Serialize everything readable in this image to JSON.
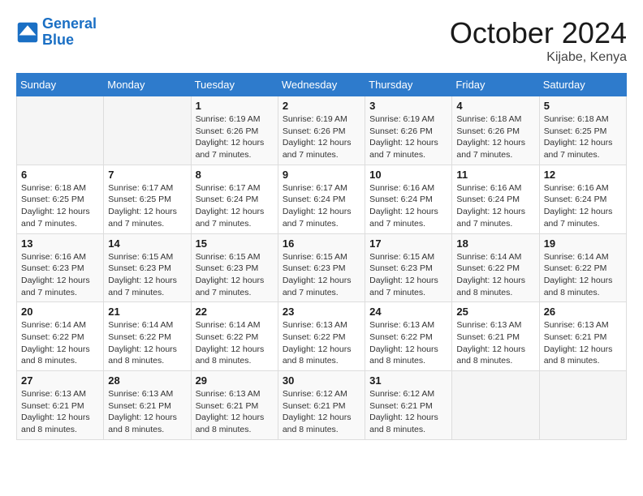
{
  "logo": {
    "line1": "General",
    "line2": "Blue"
  },
  "title": "October 2024",
  "location": "Kijabe, Kenya",
  "days_of_week": [
    "Sunday",
    "Monday",
    "Tuesday",
    "Wednesday",
    "Thursday",
    "Friday",
    "Saturday"
  ],
  "weeks": [
    [
      {
        "day": "",
        "info": ""
      },
      {
        "day": "",
        "info": ""
      },
      {
        "day": "1",
        "info": "Sunrise: 6:19 AM\nSunset: 6:26 PM\nDaylight: 12 hours and 7 minutes."
      },
      {
        "day": "2",
        "info": "Sunrise: 6:19 AM\nSunset: 6:26 PM\nDaylight: 12 hours and 7 minutes."
      },
      {
        "day": "3",
        "info": "Sunrise: 6:19 AM\nSunset: 6:26 PM\nDaylight: 12 hours and 7 minutes."
      },
      {
        "day": "4",
        "info": "Sunrise: 6:18 AM\nSunset: 6:26 PM\nDaylight: 12 hours and 7 minutes."
      },
      {
        "day": "5",
        "info": "Sunrise: 6:18 AM\nSunset: 6:25 PM\nDaylight: 12 hours and 7 minutes."
      }
    ],
    [
      {
        "day": "6",
        "info": "Sunrise: 6:18 AM\nSunset: 6:25 PM\nDaylight: 12 hours and 7 minutes."
      },
      {
        "day": "7",
        "info": "Sunrise: 6:17 AM\nSunset: 6:25 PM\nDaylight: 12 hours and 7 minutes."
      },
      {
        "day": "8",
        "info": "Sunrise: 6:17 AM\nSunset: 6:24 PM\nDaylight: 12 hours and 7 minutes."
      },
      {
        "day": "9",
        "info": "Sunrise: 6:17 AM\nSunset: 6:24 PM\nDaylight: 12 hours and 7 minutes."
      },
      {
        "day": "10",
        "info": "Sunrise: 6:16 AM\nSunset: 6:24 PM\nDaylight: 12 hours and 7 minutes."
      },
      {
        "day": "11",
        "info": "Sunrise: 6:16 AM\nSunset: 6:24 PM\nDaylight: 12 hours and 7 minutes."
      },
      {
        "day": "12",
        "info": "Sunrise: 6:16 AM\nSunset: 6:24 PM\nDaylight: 12 hours and 7 minutes."
      }
    ],
    [
      {
        "day": "13",
        "info": "Sunrise: 6:16 AM\nSunset: 6:23 PM\nDaylight: 12 hours and 7 minutes."
      },
      {
        "day": "14",
        "info": "Sunrise: 6:15 AM\nSunset: 6:23 PM\nDaylight: 12 hours and 7 minutes."
      },
      {
        "day": "15",
        "info": "Sunrise: 6:15 AM\nSunset: 6:23 PM\nDaylight: 12 hours and 7 minutes."
      },
      {
        "day": "16",
        "info": "Sunrise: 6:15 AM\nSunset: 6:23 PM\nDaylight: 12 hours and 7 minutes."
      },
      {
        "day": "17",
        "info": "Sunrise: 6:15 AM\nSunset: 6:23 PM\nDaylight: 12 hours and 7 minutes."
      },
      {
        "day": "18",
        "info": "Sunrise: 6:14 AM\nSunset: 6:22 PM\nDaylight: 12 hours and 8 minutes."
      },
      {
        "day": "19",
        "info": "Sunrise: 6:14 AM\nSunset: 6:22 PM\nDaylight: 12 hours and 8 minutes."
      }
    ],
    [
      {
        "day": "20",
        "info": "Sunrise: 6:14 AM\nSunset: 6:22 PM\nDaylight: 12 hours and 8 minutes."
      },
      {
        "day": "21",
        "info": "Sunrise: 6:14 AM\nSunset: 6:22 PM\nDaylight: 12 hours and 8 minutes."
      },
      {
        "day": "22",
        "info": "Sunrise: 6:14 AM\nSunset: 6:22 PM\nDaylight: 12 hours and 8 minutes."
      },
      {
        "day": "23",
        "info": "Sunrise: 6:13 AM\nSunset: 6:22 PM\nDaylight: 12 hours and 8 minutes."
      },
      {
        "day": "24",
        "info": "Sunrise: 6:13 AM\nSunset: 6:22 PM\nDaylight: 12 hours and 8 minutes."
      },
      {
        "day": "25",
        "info": "Sunrise: 6:13 AM\nSunset: 6:21 PM\nDaylight: 12 hours and 8 minutes."
      },
      {
        "day": "26",
        "info": "Sunrise: 6:13 AM\nSunset: 6:21 PM\nDaylight: 12 hours and 8 minutes."
      }
    ],
    [
      {
        "day": "27",
        "info": "Sunrise: 6:13 AM\nSunset: 6:21 PM\nDaylight: 12 hours and 8 minutes."
      },
      {
        "day": "28",
        "info": "Sunrise: 6:13 AM\nSunset: 6:21 PM\nDaylight: 12 hours and 8 minutes."
      },
      {
        "day": "29",
        "info": "Sunrise: 6:13 AM\nSunset: 6:21 PM\nDaylight: 12 hours and 8 minutes."
      },
      {
        "day": "30",
        "info": "Sunrise: 6:12 AM\nSunset: 6:21 PM\nDaylight: 12 hours and 8 minutes."
      },
      {
        "day": "31",
        "info": "Sunrise: 6:12 AM\nSunset: 6:21 PM\nDaylight: 12 hours and 8 minutes."
      },
      {
        "day": "",
        "info": ""
      },
      {
        "day": "",
        "info": ""
      }
    ]
  ]
}
